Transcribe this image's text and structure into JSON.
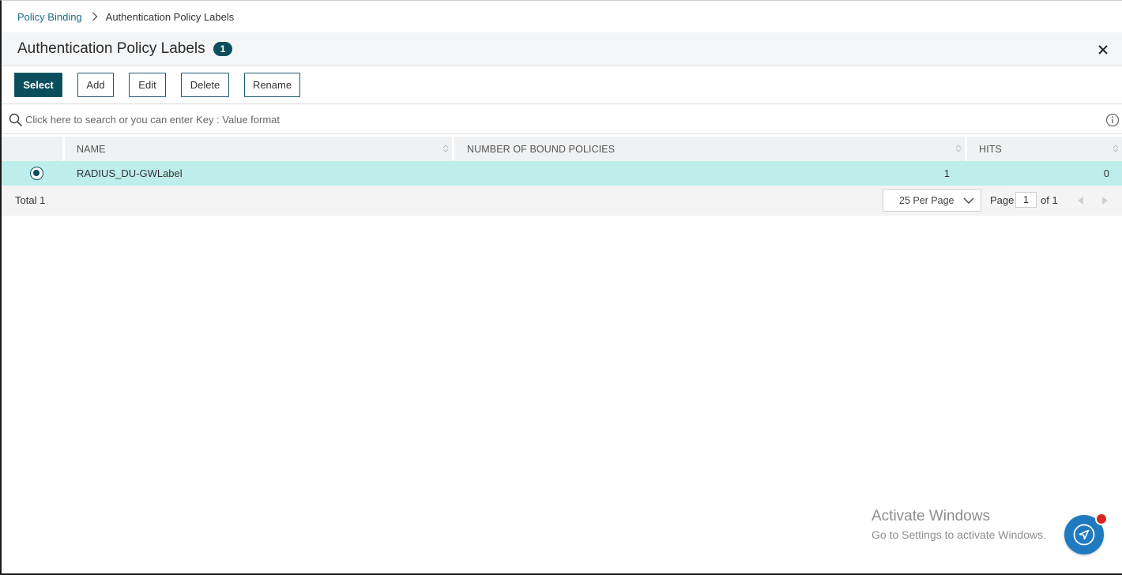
{
  "breadcrumb": {
    "parent": "Policy Binding",
    "current": "Authentication Policy Labels"
  },
  "header": {
    "title": "Authentication Policy Labels",
    "count": "1"
  },
  "toolbar": {
    "select_label": "Select",
    "add_label": "Add",
    "edit_label": "Edit",
    "delete_label": "Delete",
    "rename_label": "Rename"
  },
  "search": {
    "placeholder": "Click here to search or you can enter Key : Value format",
    "value": ""
  },
  "table": {
    "columns": [
      "NAME",
      "NUMBER OF BOUND POLICIES",
      "HITS"
    ],
    "rows": [
      {
        "name": "RADIUS_DU-GWLabel",
        "bound_policies": "1",
        "hits": "0",
        "selected": true
      }
    ]
  },
  "footer": {
    "total_label": "Total",
    "total_value": "1",
    "per_page": "25 Per Page",
    "page_label": "Page",
    "page_value": "1",
    "page_of": "of 1"
  },
  "watermark": {
    "title": "Activate Windows",
    "subtitle": "Go to Settings to activate Windows."
  },
  "colors": {
    "accent": "#0b4f5c",
    "link": "#1a6b8a",
    "selected_row": "#bdeeeb",
    "fab": "#1f7ac0",
    "notification_dot": "#d9251d"
  },
  "icons": {
    "close": "close-icon",
    "search": "search-icon",
    "info": "info-icon",
    "sort": "sort-icon",
    "dropdown": "chevron-down-icon",
    "prev": "chevron-left-icon",
    "next": "chevron-right-icon",
    "fab": "navigation-arrow-icon"
  }
}
